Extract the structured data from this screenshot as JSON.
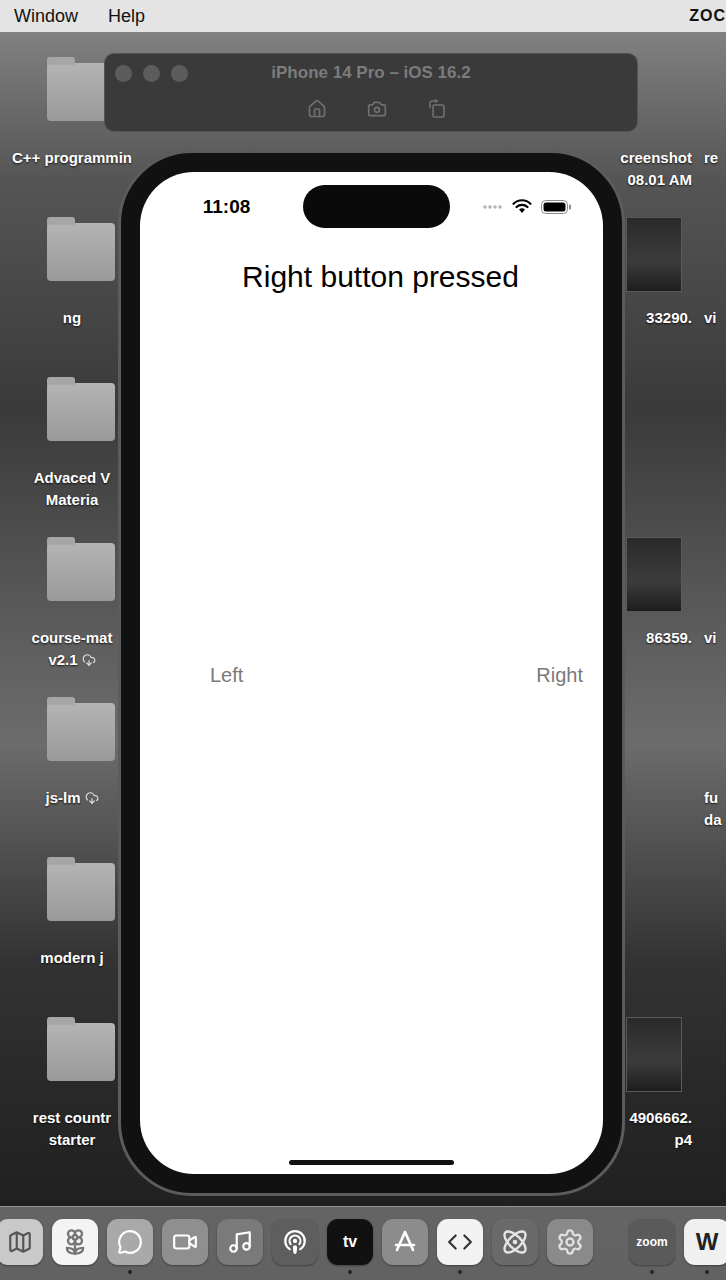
{
  "menu_bar": {
    "items": [
      "Window",
      "Help"
    ],
    "right": "ZOC"
  },
  "simulator": {
    "title": "iPhone 14 Pro – iOS 16.2"
  },
  "phone": {
    "status_time": "11:08",
    "message": "Right button pressed",
    "buttons": [
      {
        "label": "Left"
      },
      {
        "label": "Right"
      }
    ]
  },
  "desktop": {
    "left_items": [
      {
        "lines": [
          "C++ programmin"
        ],
        "in_cloud": false
      },
      {
        "lines": [
          "ng"
        ],
        "in_cloud": false
      },
      {
        "lines": [
          "Advaced V",
          "Materia"
        ],
        "in_cloud": false
      },
      {
        "lines": [
          "course-mat",
          "v2.1"
        ],
        "in_cloud": true
      },
      {
        "lines": [
          "js-lm"
        ],
        "in_cloud": true
      },
      {
        "lines": [
          "modern j"
        ],
        "in_cloud": false
      },
      {
        "lines": [
          "rest countr",
          "starter"
        ],
        "in_cloud": false
      }
    ],
    "right_items": [
      {
        "kind": "image",
        "lines": [
          "creenshot",
          "08.01 AM"
        ]
      },
      {
        "kind": "video",
        "lines": [
          "33290."
        ]
      },
      {
        "kind": "video",
        "lines": [
          "86359."
        ]
      },
      {
        "kind": "video",
        "lines": [
          "4906662.",
          "p4"
        ]
      }
    ],
    "edge_items": [
      {
        "lines": [
          "re"
        ]
      },
      {
        "lines": [
          "vi"
        ]
      },
      {
        "lines": [
          "vi"
        ]
      },
      {
        "lines": [
          "fu",
          "da"
        ]
      }
    ]
  },
  "dock": {
    "apps": [
      {
        "kind": "icon",
        "running": false
      },
      {
        "kind": "icon",
        "running": false
      },
      {
        "kind": "icon",
        "running": true
      },
      {
        "kind": "icon",
        "running": false
      },
      {
        "kind": "icon",
        "running": false
      },
      {
        "kind": "icon",
        "running": false
      },
      {
        "kind": "text",
        "label": "tv",
        "running": true
      },
      {
        "kind": "icon",
        "running": false
      },
      {
        "kind": "icon",
        "running": true
      },
      {
        "kind": "icon",
        "running": false
      },
      {
        "kind": "icon",
        "running": false
      }
    ],
    "recent": [
      {
        "kind": "text",
        "label": "zoom",
        "running": true
      },
      {
        "kind": "text",
        "label": "W",
        "running": true
      }
    ]
  }
}
